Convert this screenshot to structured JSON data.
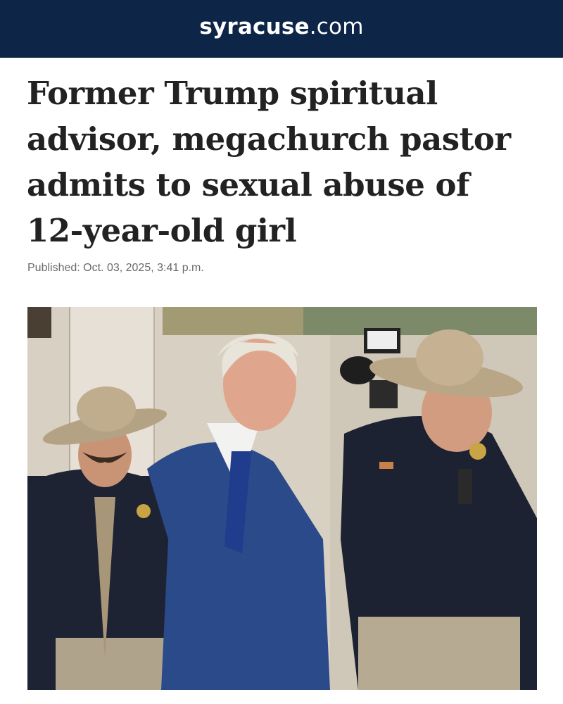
{
  "header": {
    "logo_bold": "syracuse",
    "logo_light": ".com"
  },
  "article": {
    "headline": "Former Trump spiritual advisor, megachurch pastor admits to sexual abuse of 12-year-old girl",
    "published": "Published: Oct. 03, 2025, 3:41 p.m."
  },
  "photo": {
    "subject": "man in blue suit escorted by two sheriff's deputies in cowboy hats"
  },
  "colors": {
    "header_bg": "#0d2547",
    "headline_text": "#222222",
    "meta_text": "#6a6a6a"
  }
}
